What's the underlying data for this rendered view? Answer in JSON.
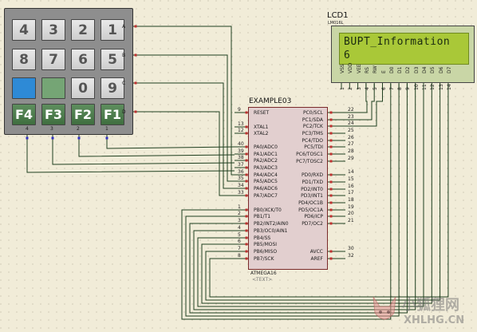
{
  "keypad": {
    "keys": [
      {
        "label": "4",
        "style": "num"
      },
      {
        "label": "3",
        "style": "num"
      },
      {
        "label": "2",
        "style": "num"
      },
      {
        "label": "1",
        "style": "num"
      },
      {
        "label": "8",
        "style": "num"
      },
      {
        "label": "7",
        "style": "num"
      },
      {
        "label": "6",
        "style": "num"
      },
      {
        "label": "5",
        "style": "num"
      },
      {
        "label": "",
        "style": "blue"
      },
      {
        "label": "",
        "style": "green"
      },
      {
        "label": "0",
        "style": "num"
      },
      {
        "label": "9",
        "style": "num"
      },
      {
        "label": "F4",
        "style": "fkey"
      },
      {
        "label": "F3",
        "style": "fkey"
      },
      {
        "label": "F2",
        "style": "fkey"
      },
      {
        "label": "F1",
        "style": "fkey"
      }
    ],
    "row_labels": [
      "A",
      "B",
      "C",
      "D"
    ],
    "col_labels": [
      "4",
      "3",
      "2",
      "1"
    ]
  },
  "lcd": {
    "name": "LCD1",
    "part": "LM016L",
    "line1": "BUPT_Information",
    "line2": "6",
    "pin_labels": [
      "VSS",
      "VDD",
      "VEE",
      "RS",
      "RW",
      "E",
      "D0",
      "D1",
      "D2",
      "D3",
      "D4",
      "D5",
      "D6",
      "D7"
    ],
    "pin_numbers": [
      "1",
      "2",
      "3",
      "4",
      "5",
      "6",
      "7",
      "8",
      "9",
      "10",
      "11",
      "12",
      "13",
      "14"
    ]
  },
  "mcu": {
    "name": "EXAMPLE03",
    "part": "ATMEGA16",
    "text_tag": "<TEXT>",
    "left_pins": [
      {
        "label": "RESET",
        "num": "9"
      },
      {
        "label": "XTAL1",
        "num": "13"
      },
      {
        "label": "XTAL2",
        "num": "12"
      },
      {
        "label": "PA0/ADC0",
        "num": "40"
      },
      {
        "label": "PA1/ADC1",
        "num": "39"
      },
      {
        "label": "PA2/ADC2",
        "num": "38"
      },
      {
        "label": "PA3/ADC3",
        "num": "37"
      },
      {
        "label": "PA4/ADC4",
        "num": "36"
      },
      {
        "label": "PA5/ADC5",
        "num": "35"
      },
      {
        "label": "PA6/ADC6",
        "num": "34"
      },
      {
        "label": "PA7/ADC7",
        "num": "33"
      },
      {
        "label": "PB0/XCK/T0",
        "num": "1"
      },
      {
        "label": "PB1/T1",
        "num": "2"
      },
      {
        "label": "PB2/INT2/AIN0",
        "num": "3"
      },
      {
        "label": "PB3/OC0/AIN1",
        "num": "4"
      },
      {
        "label": "PB4/SS",
        "num": "5"
      },
      {
        "label": "PB5/MOSI",
        "num": "6"
      },
      {
        "label": "PB6/MISO",
        "num": "7"
      },
      {
        "label": "PB7/SCK",
        "num": "8"
      }
    ],
    "right_pins": [
      {
        "label": "PC0/SCL",
        "num": "22"
      },
      {
        "label": "PC1/SDA",
        "num": "23"
      },
      {
        "label": "PC2/TCK",
        "num": "24"
      },
      {
        "label": "PC3/TMS",
        "num": "25"
      },
      {
        "label": "PC4/TDO",
        "num": "26"
      },
      {
        "label": "PC5/TDI",
        "num": "27"
      },
      {
        "label": "PC6/TOSC1",
        "num": "28"
      },
      {
        "label": "PC7/TOSC2",
        "num": "29"
      },
      {
        "label": "PD0/RXD",
        "num": "14"
      },
      {
        "label": "PD1/TXD",
        "num": "15"
      },
      {
        "label": "PD2/INT0",
        "num": "16"
      },
      {
        "label": "PD3/INT1",
        "num": "17"
      },
      {
        "label": "PD4/OC1B",
        "num": "18"
      },
      {
        "label": "PD5/OC1A",
        "num": "19"
      },
      {
        "label": "PD6/ICP",
        "num": "20"
      },
      {
        "label": "PD7/OC2",
        "num": "21"
      },
      {
        "label": "AVCC",
        "num": "30"
      },
      {
        "label": "AREF",
        "num": "32"
      }
    ]
  },
  "watermark": {
    "text_cn": "小狐狸网",
    "text_en": "XHLHG.CN"
  },
  "colors": {
    "background": "#f1ecd8",
    "grid_dot": "#b9b3a0",
    "wire": "#1f3f1f",
    "pin_red": "#c03030",
    "pin_blue": "#3030c0",
    "mcu_fill": "#e2cfcf",
    "lcd_screen": "#a9c838"
  }
}
